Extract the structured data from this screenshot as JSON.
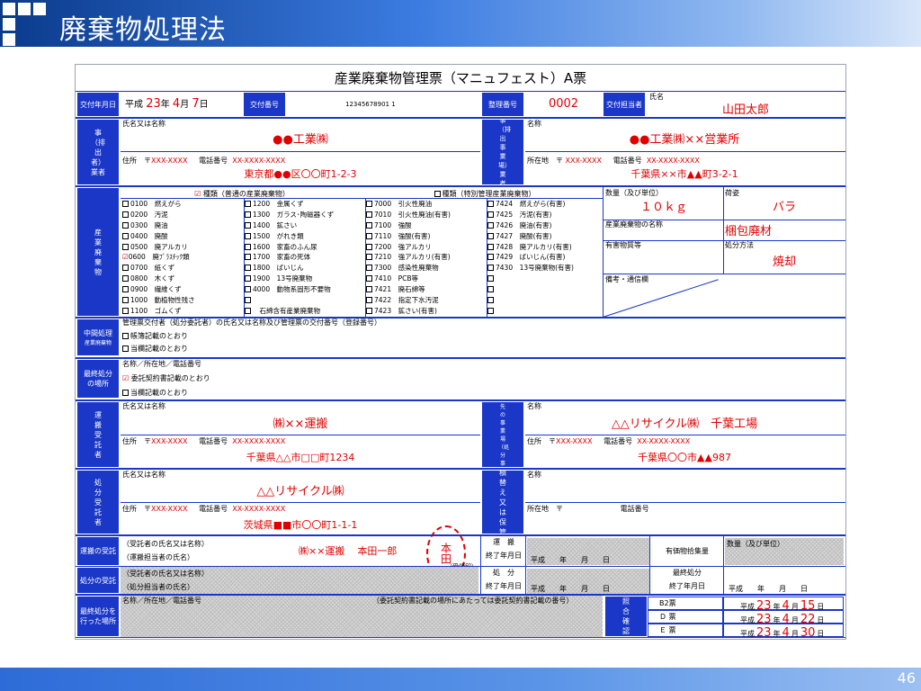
{
  "slide": {
    "title": "廃棄物処理法",
    "page": "46"
  },
  "form": {
    "title": "産業廃棄物管理票（マニュフェスト）A票",
    "issue_date_label": "交付年月日",
    "issue_era": "平成",
    "issue_year": "23",
    "issue_year_unit": "年",
    "issue_month": "4",
    "issue_month_unit": "月",
    "issue_day": "7",
    "issue_day_unit": "日",
    "issue_no_label": "交付番号",
    "issue_no": "12345678901 1",
    "ref_no_label": "整理番号",
    "ref_no": "0002",
    "person_label": "交付担当者",
    "person_name_label": "氏名",
    "person_name": "山田太郎"
  },
  "generator": {
    "label": "事（排出者）業者",
    "name_label": "氏名又は名称",
    "name": "●●工業㈱",
    "address_label": "住所　〒",
    "zip": "XXX-XXXX",
    "phone_label": "電話番号",
    "phone": "XX-XXXX-XXXX",
    "address": "東京都●●区〇〇町1-2-3"
  },
  "site": {
    "label": "事（排出事業場）業者",
    "name_label": "名称",
    "name": "●●工業㈱××営業所",
    "address_label": "所在地　〒",
    "zip": "XXX-XXXX",
    "phone_label": "電話番号",
    "phone": "XX-XXXX-XXXX",
    "address": "千葉県××市▲▲町3-2-1"
  },
  "waste": {
    "label": "産業廃棄物",
    "type_normal": "種類（普通の産業廃棄物）",
    "type_special": "種類（特別管理産業廃棄物）",
    "col1": [
      "0100　燃えがら",
      "0200　汚泥",
      "0300　廃油",
      "0400　廃酸",
      "0500　廃アルカリ",
      "0600　廃ﾌﾟﾗｽﾁｯｸ類",
      "0700　紙くず",
      "0800　木くず",
      "0900　繊維くず",
      "1000　動植物性残さ",
      "1100　ゴムくず"
    ],
    "col2": [
      "1200　金属くず",
      "1300　ガラス･陶磁器くず",
      "1400　鉱さい",
      "1500　がれき類",
      "1600　家畜のふん尿",
      "1700　家畜の死体",
      "1800　ばいじん",
      "1900　13号廃棄物",
      "4000　動物系固形不要物",
      "",
      "　石綿含有産業廃棄物"
    ],
    "col3": [
      "7000　引火性廃油",
      "7010　引火性廃油(有害)",
      "7100　強酸",
      "7110　強酸(有害)",
      "7200　強アルカリ",
      "7210　強アルカリ(有害)",
      "7300　感染性廃棄物",
      "7410　PCB等",
      "7421　廃石綿等",
      "7422　指定下水汚泥",
      "7423　鉱さい(有害)"
    ],
    "col4": [
      "7424　燃えがら(有害)",
      "7425　汚泥(有害)",
      "7426　廃油(有害)",
      "7427　廃酸(有害)",
      "7428　廃アルカリ(有害)",
      "7429　ばいじん(有害)",
      "7430　13号廃棄物(有害)",
      "",
      "",
      "",
      ""
    ],
    "quantity_label": "数量（及び単位）",
    "quantity": "１０ｋｇ",
    "form_label": "荷姿",
    "form": "バラ",
    "name_label": "産業廃棄物の名称",
    "name": "梱包廃材",
    "hazard_label": "有害物質等",
    "method_label": "処分方法",
    "method": "焼却",
    "notes_label": "備考・通信欄"
  },
  "intermediate": {
    "label": "中間処理",
    "sublabel": "産業廃棄物",
    "text": "管理票交付者（処分委託者）の氏名又は名称及び管理票の交付番号（登録番号）",
    "opt1": "帳簿記載のとおり",
    "opt2": "当欄記載のとおり"
  },
  "final_place": {
    "label": "最終処分の場所",
    "text": "名称／所在地／電話番号",
    "opt1": "委託契約書記載のとおり",
    "opt2": "当欄記載のとおり"
  },
  "carrier": {
    "label": "運搬受託者",
    "name_label": "氏名又は名称",
    "name": "㈱××運搬",
    "address_label": "住所　〒",
    "zip": "XXX-XXXX",
    "phone_label": "電話番号",
    "phone": "XX-XXXX-XXXX",
    "address": "千葉県△△市□□町1234",
    "dest_label": "運搬先の事業場（処分事業場）",
    "dest_name_label": "名称",
    "dest_name": "△△リサイクル㈱　千葉工場",
    "dest_address_label": "住所　〒",
    "dest_zip": "XXX-XXXX",
    "dest_phone_label": "電話番号",
    "dest_phone": "XX-XXXX-XXXX",
    "dest_address": "千葉県〇〇市▲▲987"
  },
  "processor": {
    "label": "処分受託者",
    "name_label": "氏名又は名称",
    "name": "△△リサイクル㈱",
    "address_label": "住所　〒",
    "zip": "XXX-XXXX",
    "phone_label": "電話番号",
    "phone": "XX-XXXX-XXXX",
    "address": "茨城県■■市〇〇町1-1-1",
    "storage_label": "積替え又は保管",
    "storage_name_label": "名称",
    "storage_address_label": "所在地　〒",
    "storage_phone_label": "電話番号"
  },
  "receipt": {
    "carrier_label": "運搬の受託",
    "c_name_label": "（受託者の氏名又は名称）",
    "c_person_label": "（運搬担当者の氏名）",
    "c_name": "㈱××運搬",
    "c_person": "本田一郎",
    "stamp": "本田",
    "seal_label": "（受領印）",
    "carry_end_label": "運　搬",
    "carry_end_sub": "終了年月日",
    "date_blank": "平成　　年　　月　　日",
    "valuables_label": "有価物拾集量",
    "qty_label": "数量（及び単位）",
    "proc_label": "処分の受託",
    "p_name_label": "（受託者の氏名又は名称）",
    "p_person_label": "（処分担当者の氏名）",
    "proc_end_label": "処　分",
    "proc_end_sub": "終了年月日",
    "final_end_label": "最終処分",
    "final_end_sub": "終了年月日"
  },
  "final_done": {
    "label": "最終処分を行った場所",
    "text": "名称／所在地／電話番号",
    "note": "（委託契約書記載の場所にあたっては委託契約書記載の番号）"
  },
  "check": {
    "label": "照合確認",
    "rows": [
      {
        "name": "B2票",
        "era": "平成",
        "y": "23",
        "m": "4",
        "d": "15"
      },
      {
        "name": "Ｄ 票",
        "era": "平成",
        "y": "23",
        "m": "4",
        "d": "22"
      },
      {
        "name": "Ｅ 票",
        "era": "平成",
        "y": "23",
        "m": "4",
        "d": "30"
      }
    ],
    "y_unit": "年",
    "m_unit": "月",
    "d_unit": "日"
  }
}
